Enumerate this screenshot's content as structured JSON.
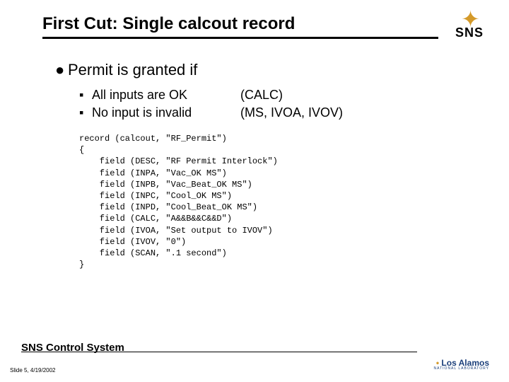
{
  "title": "First Cut: Single calcout record",
  "sns_label": "SNS",
  "level1": "Permit is granted if",
  "level2": [
    {
      "text": "All inputs are OK",
      "note": "(CALC)"
    },
    {
      "text": "No input is invalid",
      "note": "(MS, IVOA, IVOV)"
    }
  ],
  "code": "record (calcout, \"RF_Permit\")\n{\n    field (DESC, \"RF Permit Interlock\")\n    field (INPA, \"Vac_OK MS\")\n    field (INPB, \"Vac_Beat_OK MS\")\n    field (INPC, \"Cool_OK MS\")\n    field (INPD, \"Cool_Beat_OK MS\")\n    field (CALC, \"A&&B&&C&&D\")\n    field (IVOA, \"Set output to IVOV\")\n    field (IVOV, \"0\")\n    field (SCAN, \".1 second\")\n}",
  "footer_title": "SNS Control System",
  "slide_meta": "Slide 5, 4/19/2002",
  "lanl": {
    "main_a": "Los",
    "main_b": "Alamos",
    "sub": "NATIONAL LABORATORY"
  }
}
